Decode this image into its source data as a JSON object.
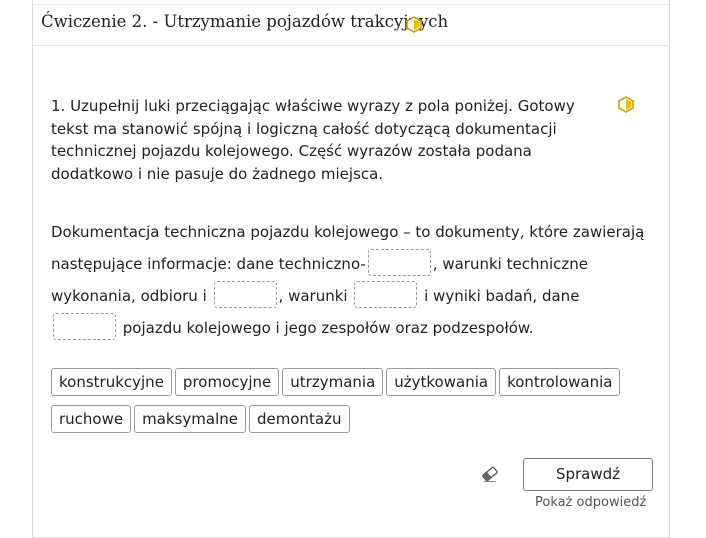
{
  "header": {
    "title": "Ćwiczenie 2. - Utrzymanie pojazdów trakcyjnych",
    "badge_icon": "hexagon-half-icon",
    "accent": "#c9a400"
  },
  "question": {
    "instruction": "1. Uzupełnij luki przeciągając właściwe wyrazy z pola poniżej. Gotowy tekst ma stanowić spójną i logiczną całość dotyczącą dokumentacji technicznej pojazdu kolejowego. Część wyrazów została podana dodatkowo i nie pasuje do żadnego miejsca.",
    "passage": {
      "part1": "Dokumentacja techniczna pojazdu kolejowego – to dokumenty, które zawierają następujące informacje: dane techniczno-",
      "part2": ", warunki techniczne wykonania, odbioru i",
      "part3": ", warunki",
      "part4": "i wyniki badań, dane",
      "part5": "pojazdu kolejowego i jego zespołów oraz podzespołów."
    },
    "word_bank": [
      "konstrukcyjne",
      "promocyjne",
      "utrzymania",
      "użytkowania",
      "kontrolowania",
      "ruchowe",
      "maksymalne",
      "demontażu"
    ]
  },
  "controls": {
    "reset_icon": "eraser-icon",
    "check_label": "Sprawdź",
    "show_answer_label": "Pokaż odpowiedź"
  }
}
